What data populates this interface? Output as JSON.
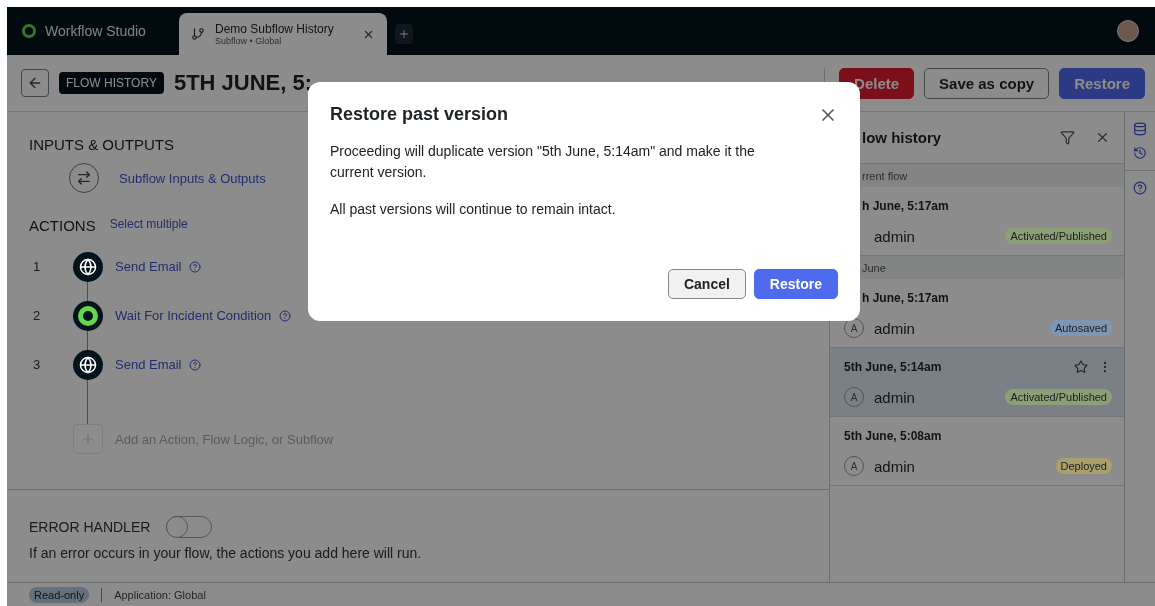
{
  "window": {
    "brand": "Workflow Studio"
  },
  "tabs": [
    {
      "title": "Demo Subflow History",
      "subtitle": "Subflow • Global",
      "selected": true
    }
  ],
  "toolbar": {
    "badge": "FLOW HISTORY",
    "title": "5TH JUNE, 5:",
    "buttons": [
      {
        "label": "Delete",
        "kind": "danger"
      },
      {
        "label": "Save as copy",
        "kind": "secondary"
      },
      {
        "label": "Restore",
        "kind": "primary"
      }
    ]
  },
  "inputs_outputs": {
    "heading": "INPUTS & OUTPUTS",
    "link": "Subflow Inputs & Outputs"
  },
  "actions": {
    "heading": "ACTIONS",
    "select_link": "Select multiple",
    "add_label": "Add an Action, Flow Logic, or Subflow",
    "items": [
      {
        "number": "1",
        "label": "Send Email",
        "kind": "globe"
      },
      {
        "number": "2",
        "label": "Wait For Incident Condition",
        "kind": "wait"
      },
      {
        "number": "3",
        "label": "Send Email",
        "kind": "globe"
      }
    ]
  },
  "error_handler": {
    "label": "ERROR HANDLER",
    "on": false,
    "description": "If an error occurs in your flow, the actions you add here will run."
  },
  "history": {
    "title": "low history",
    "groups": [
      {
        "label": "rrent flow",
        "entries": [
          {
            "time": "h June, 5:17am",
            "user": "admin",
            "status": "Activated/Published",
            "color": "#8ca078",
            "selected": false
          }
        ]
      },
      {
        "label": "June",
        "entries": [
          {
            "time": "h June, 5:17am",
            "avatar": "A",
            "user": "admin",
            "status": "Autosaved",
            "color": "#7d96b4",
            "selected": false
          },
          {
            "time": "5th June, 5:14am",
            "avatar": "A",
            "user": "admin",
            "status": "Activated/Published",
            "color": "#8ca078",
            "selected": true
          },
          {
            "time": "5th June, 5:08am",
            "avatar": "A",
            "user": "admin",
            "status": "Deployed",
            "color": "#aaa06e",
            "selected": false
          }
        ]
      }
    ]
  },
  "dialog": {
    "title": "Restore past version",
    "paragraphs": [
      "Proceeding will duplicate version \"5th June, 5:14am\" and make it the current version.",
      "All past versions will continue to remain intact."
    ],
    "buttons": [
      {
        "label": "Cancel",
        "kind": "secondary"
      },
      {
        "label": "Restore",
        "kind": "primary"
      }
    ]
  },
  "status_bar": {
    "badge": "Read-only",
    "application": "Application: Global"
  }
}
